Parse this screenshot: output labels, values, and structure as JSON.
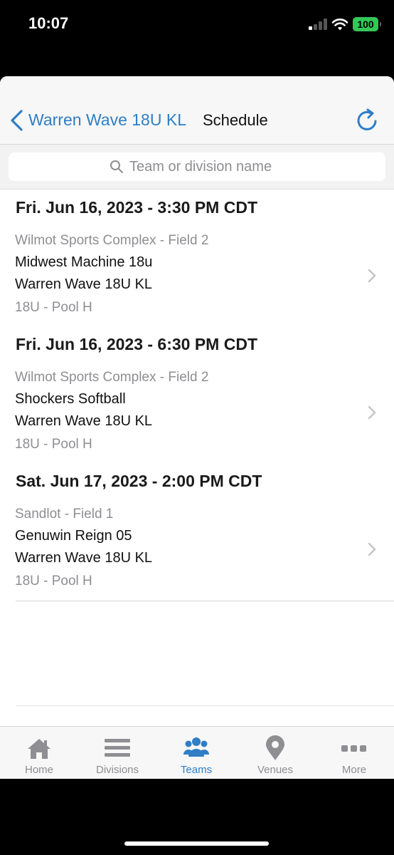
{
  "status": {
    "time": "10:07",
    "battery": "100"
  },
  "nav": {
    "back_label": "Warren Wave 18U KL",
    "title": "Schedule"
  },
  "search": {
    "placeholder": "Team or division name"
  },
  "events": [
    {
      "date": "Fri. Jun 16, 2023 - 3:30 PM CDT",
      "venue": "Wilmot Sports Complex - Field 2",
      "team1": "Midwest Machine 18u",
      "team2": "Warren Wave 18U KL",
      "division": "18U - Pool H"
    },
    {
      "date": "Fri. Jun 16, 2023 - 6:30 PM CDT",
      "venue": "Wilmot Sports Complex - Field 2",
      "team1": "Shockers Softball",
      "team2": "Warren Wave 18U KL",
      "division": "18U - Pool H"
    },
    {
      "date": "Sat. Jun 17, 2023 - 2:00 PM CDT",
      "venue": "Sandlot - Field 1",
      "team1": "Genuwin Reign 05",
      "team2": "Warren Wave 18U KL",
      "division": "18U - Pool H"
    }
  ],
  "tabs": [
    {
      "label": "Home",
      "icon": "home-icon"
    },
    {
      "label": "Divisions",
      "icon": "list-icon"
    },
    {
      "label": "Teams",
      "icon": "people-icon",
      "active": true
    },
    {
      "label": "Venues",
      "icon": "location-pin-icon"
    },
    {
      "label": "More",
      "icon": "more-dots-icon"
    }
  ],
  "colors": {
    "accent": "#2f7ec6",
    "inactive": "#8e8e93",
    "battery": "#34c759"
  }
}
